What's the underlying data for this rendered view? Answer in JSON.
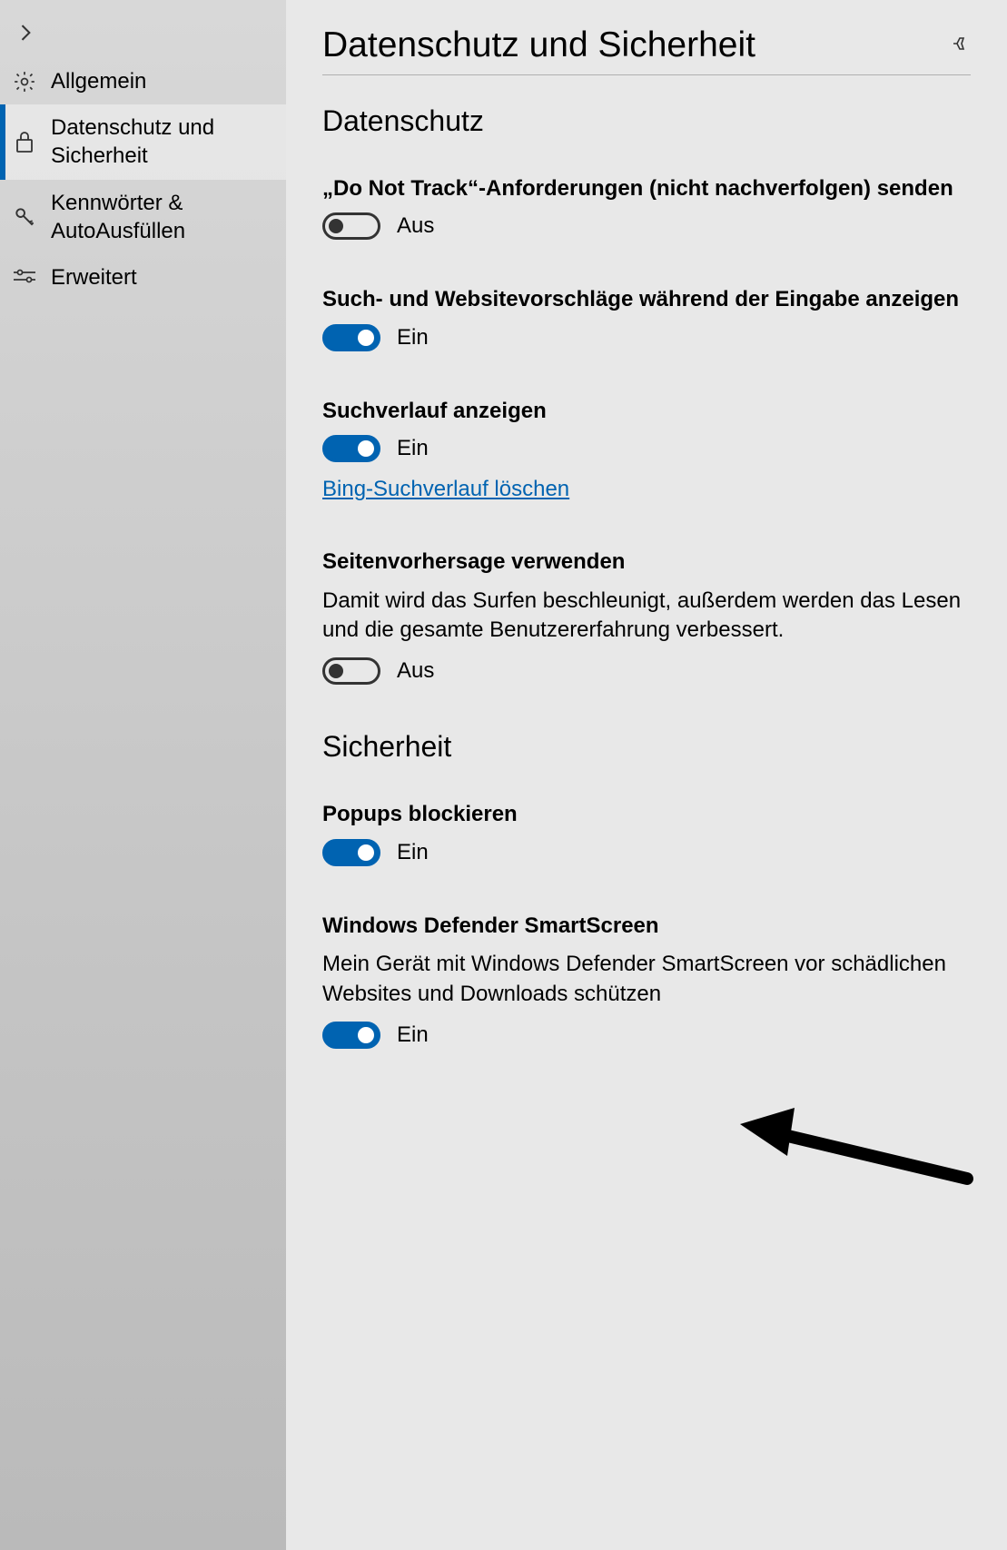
{
  "sidebar": {
    "items": [
      {
        "label": "Allgemein"
      },
      {
        "label": "Datenschutz und Sicherheit"
      },
      {
        "label": "Kennwörter & AutoAusfüllen"
      },
      {
        "label": "Erweitert"
      }
    ]
  },
  "page": {
    "title": "Datenschutz und Sicherheit"
  },
  "sections": {
    "privacy": {
      "heading": "Datenschutz"
    },
    "security": {
      "heading": "Sicherheit"
    }
  },
  "settings": {
    "dnt": {
      "label": "„Do Not Track“-Anforderungen (nicht nachverfolgen) senden",
      "state": "Aus"
    },
    "suggestions": {
      "label": "Such- und Websitevorschläge während der Eingabe anzeigen",
      "state": "Ein"
    },
    "history": {
      "label": "Suchverlauf anzeigen",
      "state": "Ein",
      "link": "Bing-Suchverlauf löschen"
    },
    "prediction": {
      "label": "Seitenvorhersage verwenden",
      "desc": "Damit wird das Surfen beschleunigt, außerdem werden das Lesen und die gesamte Benutzererfahrung verbessert.",
      "state": "Aus"
    },
    "popups": {
      "label": "Popups blockieren",
      "state": "Ein"
    },
    "smartscreen": {
      "label": "Windows Defender SmartScreen",
      "desc": "Mein Gerät mit Windows Defender SmartScreen vor schädlichen Websites und Downloads schützen",
      "state": "Ein"
    }
  }
}
